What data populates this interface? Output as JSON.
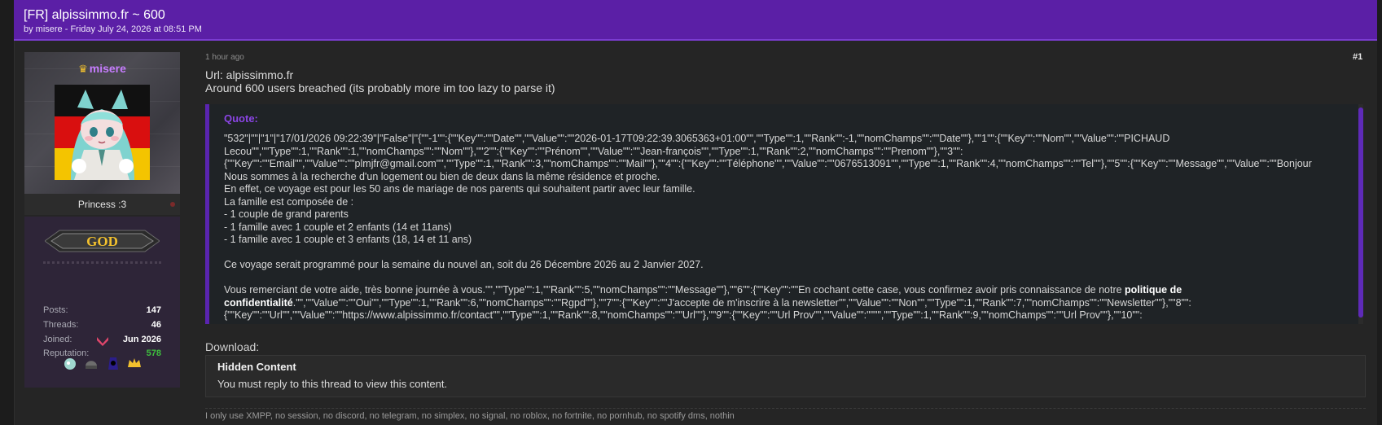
{
  "thread": {
    "title": "[FR] alpissimmo.fr ~ 600",
    "meta": "by misere - Friday July 24, 2026 at 08:51 PM"
  },
  "author": {
    "name": "misere",
    "user_title": "Princess :3",
    "rank": "GOD",
    "stats": [
      {
        "label": "Posts:",
        "value": "147"
      },
      {
        "label": "Threads:",
        "value": "46"
      },
      {
        "label": "Joined:",
        "value": "Jun 2026"
      },
      {
        "label": "Reputation:",
        "value": "578"
      }
    ],
    "colors": {
      "name": "#c77dff",
      "reputation": "#3fbf3f",
      "flag_black": "#111111",
      "flag_red": "#d90f0f",
      "flag_gold": "#f4c400"
    },
    "icons": [
      "crown-icon",
      "chevron-award-icon",
      "award-blob-icon",
      "award-helmet-icon",
      "award-hood-icon",
      "award-crown-icon"
    ]
  },
  "post": {
    "time": "1 hour ago",
    "number": "#1",
    "lines": [
      "Url: alpissimmo.fr",
      "Around 600 users breached (its probably more im too lazy to parse it)"
    ],
    "quote_label": "Quote:",
    "quote_paragraphs": [
      "\"532\"|\"\"|\"1\"|\"17/01/2026 09:22:39\"|\"False\"|\"{\"\"-1\"\":{\"\"Key\"\":\"\"Date\"\",\"\"Value\"\":\"\"2026-01-17T09:22:39.3065363+01:00\"\",\"\"Type\"\":1,\"\"Rank\"\":-1,\"\"nomChamps\"\":\"\"Date\"\"},\"\"1\"\":{\"\"Key\"\":\"\"Nom\"\",\"\"Value\"\":\"\"PICHAUD Lecou\"\",\"\"Type\"\":1,\"\"Rank\"\":1,\"\"nomChamps\"\":\"\"Nom\"\"},\"\"2\"\":{\"\"Key\"\":\"\"Prénom\"\",\"\"Value\"\":\"\"Jean-françois\"\",\"\"Type\"\":1,\"\"Rank\"\":2,\"\"nomChamps\"\":\"\"Prenom\"\"},\"\"3\"\": {\"\"Key\"\":\"\"Email\"\",\"\"Value\"\":\"\"plmjfr@gmail.com\"\",\"\"Type\"\":1,\"\"Rank\"\":3,\"\"nomChamps\"\":\"\"Mail\"\"},\"\"4\"\":{\"\"Key\"\":\"\"Téléphone\"\",\"\"Value\"\":\"\"0676513091\"\",\"\"Type\"\":1,\"\"Rank\"\":4,\"\"nomChamps\"\":\"\"Tel\"\"},\"\"5\"\":{\"\"Key\"\":\"\"Message\"\",\"\"Value\"\":\"\"Bonjour\nNous sommes à la recherche d'un logement ou bien de deux dans la même résidence et proche.\nEn effet, ce voyage est pour les 50 ans de mariage de nos parents qui souhaitent partir avec leur famille.\nLa famille est composée de :\n- 1 couple de grand parents\n- 1 famille avec 1 couple et 2 enfants (14 et 11ans)\n- 1 famille avec 1 couple et 3 enfants (18, 14 et 11 ans)",
      "Ce voyage serait programmé pour la semaine du nouvel an, soit du 26 Décembre 2026 au 2 Janvier 2027.",
      "Vous remerciant de votre aide, très bonne journée à vous.\"\",\"\"Type\"\":1,\"\"Rank\"\":5,\"\"nomChamps\"\":\"\"Message\"\"},\"\"6\"\":{\"\"Key\"\":\"\"En cochant cette case, vous confirmez avoir pris connaissance de notre "
    ],
    "quote_bold": "politique de confidentialité",
    "quote_tail": ".\"\",\"\"Value\"\":\"\"Oui\"\",\"\"Type\"\":1,\"\"Rank\"\":6,\"\"nomChamps\"\":\"\"Rgpd\"\"},\"\"7\"\":{\"\"Key\"\":\"\"J'accepte de m'inscrire à la newsletter\"\",\"\"Value\"\":\"\"Non\"\",\"\"Type\"\":1,\"\"Rank\"\":7,\"\"nomChamps\"\":\"\"Newsletter\"\"},\"\"8\"\": {\"\"Key\"\":\"\"Url\"\",\"\"Value\"\":\"\"https://www.alpissimmo.fr/contact\"\",\"\"Type\"\":1,\"\"Rank\"\":8,\"\"nomChamps\"\":\"\"Url\"\"},\"\"9\"\":{\"\"Key\"\":\"\"Url Prov\"\",\"\"Value\"\":\"\"\"\",\"\"Type\"\":1,\"\"Rank\"\":9,\"\"nomChamps\"\":\"\"Url Prov\"\"},\"\"10\"\":",
    "download_label": "Download:",
    "hidden_title": "Hidden Content",
    "hidden_sub": "You must reply to this thread to view this content.",
    "signature": "I only use XMPP, no session, no discord, no telegram, no simplex, no signal, no roblox, no fortnite, no pornhub, no spotify dms, nothin",
    "colors": {
      "header": "#5b1fa6",
      "quote_border": "#5a24b0",
      "quote_label": "#8b45e6"
    }
  }
}
